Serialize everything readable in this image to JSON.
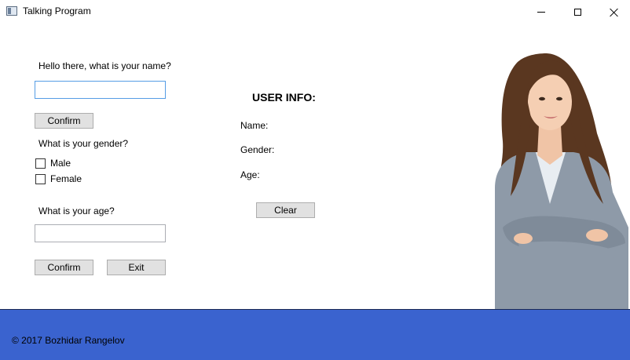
{
  "window": {
    "title": "Talking Program",
    "minimize_icon": "minimize-icon",
    "maximize_icon": "maximize-icon",
    "close_icon": "close-icon"
  },
  "name_section": {
    "prompt": "Hello there, what is your name?",
    "value": "",
    "confirm_label": "Confirm"
  },
  "gender_section": {
    "prompt": "What is your gender?",
    "options": [
      "Male",
      "Female"
    ]
  },
  "age_section": {
    "prompt": "What is your age?",
    "value": "",
    "confirm_label": "Confirm",
    "exit_label": "Exit"
  },
  "user_info": {
    "title": "USER INFO:",
    "name_label": "Name:",
    "gender_label": "Gender:",
    "age_label": "Age:",
    "clear_label": "Clear"
  },
  "footer": {
    "text": "© 2017 Bozhidar Rangelov",
    "color": "#3a63cf"
  }
}
